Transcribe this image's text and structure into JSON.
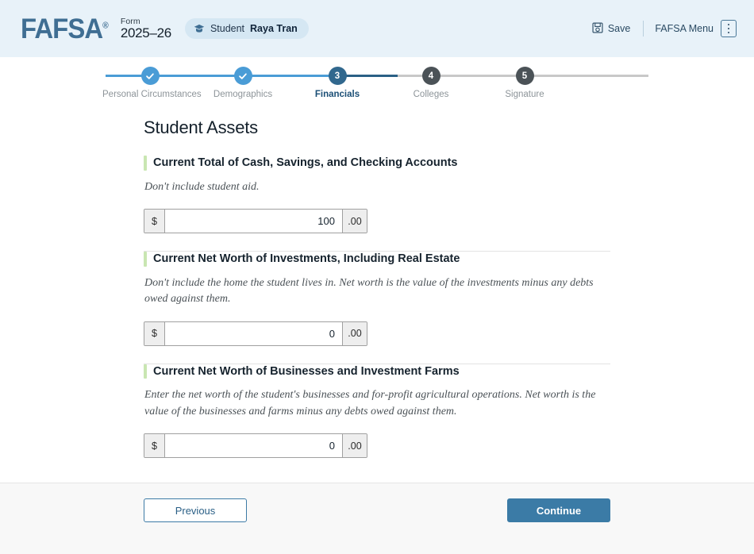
{
  "header": {
    "logo_text": "FAFSA",
    "logo_reg": "®",
    "form_label": "Form",
    "form_year": "2025–26",
    "student_chip": {
      "icon": "graduation-cap-icon",
      "role": "Student",
      "name": "Raya Tran"
    },
    "save_label": "Save",
    "save_icon": "save-floppy-icon",
    "menu_label": "FAFSA Menu",
    "menu_icon": "kebab-menu-icon",
    "background_color": "#e8f2f9",
    "brand_color": "#3f6e93"
  },
  "stepper": {
    "steps": [
      {
        "number": "1",
        "label": "Personal Circumstances",
        "state": "done",
        "glyph": "check-icon"
      },
      {
        "number": "2",
        "label": "Demographics",
        "state": "done",
        "glyph": "check-icon"
      },
      {
        "number": "3",
        "label": "Financials",
        "state": "current",
        "glyph": "3"
      },
      {
        "number": "4",
        "label": "Colleges",
        "state": "todo",
        "glyph": "4"
      },
      {
        "number": "5",
        "label": "Signature",
        "state": "todo",
        "glyph": "5"
      }
    ],
    "done_color": "#4a9cd6",
    "current_color": "#31688e",
    "todo_color": "#4b5257",
    "track_done_color": "#4a9cd6",
    "track_current_color": "#2a6085",
    "track_todo_color": "#c8c8c8"
  },
  "main": {
    "title": "Student Assets",
    "accent_color": "#c9e6b2",
    "questions": [
      {
        "label": "Current Total of Cash, Savings, and Checking Accounts",
        "help": "Don't include student aid.",
        "prefix": "$",
        "value": "100",
        "suffix": ".00",
        "placeholder": ""
      },
      {
        "label": "Current Net Worth of Investments, Including Real Estate",
        "help": "Don't include the home the student lives in. Net worth is the value of the investments minus any debts owed against them.",
        "prefix": "$",
        "value": "0",
        "suffix": ".00",
        "placeholder": ""
      },
      {
        "label": "Current Net Worth of Businesses and Investment Farms",
        "help": "Enter the net worth of the student's businesses and for-profit agricultural operations. Net worth is the value of the businesses and farms minus any debts owed against them.",
        "prefix": "$",
        "value": "0",
        "suffix": ".00",
        "placeholder": ""
      }
    ]
  },
  "footer": {
    "previous_label": "Previous",
    "continue_label": "Continue",
    "primary_color": "#3b7ba6",
    "background_color": "#f8f8f8"
  }
}
